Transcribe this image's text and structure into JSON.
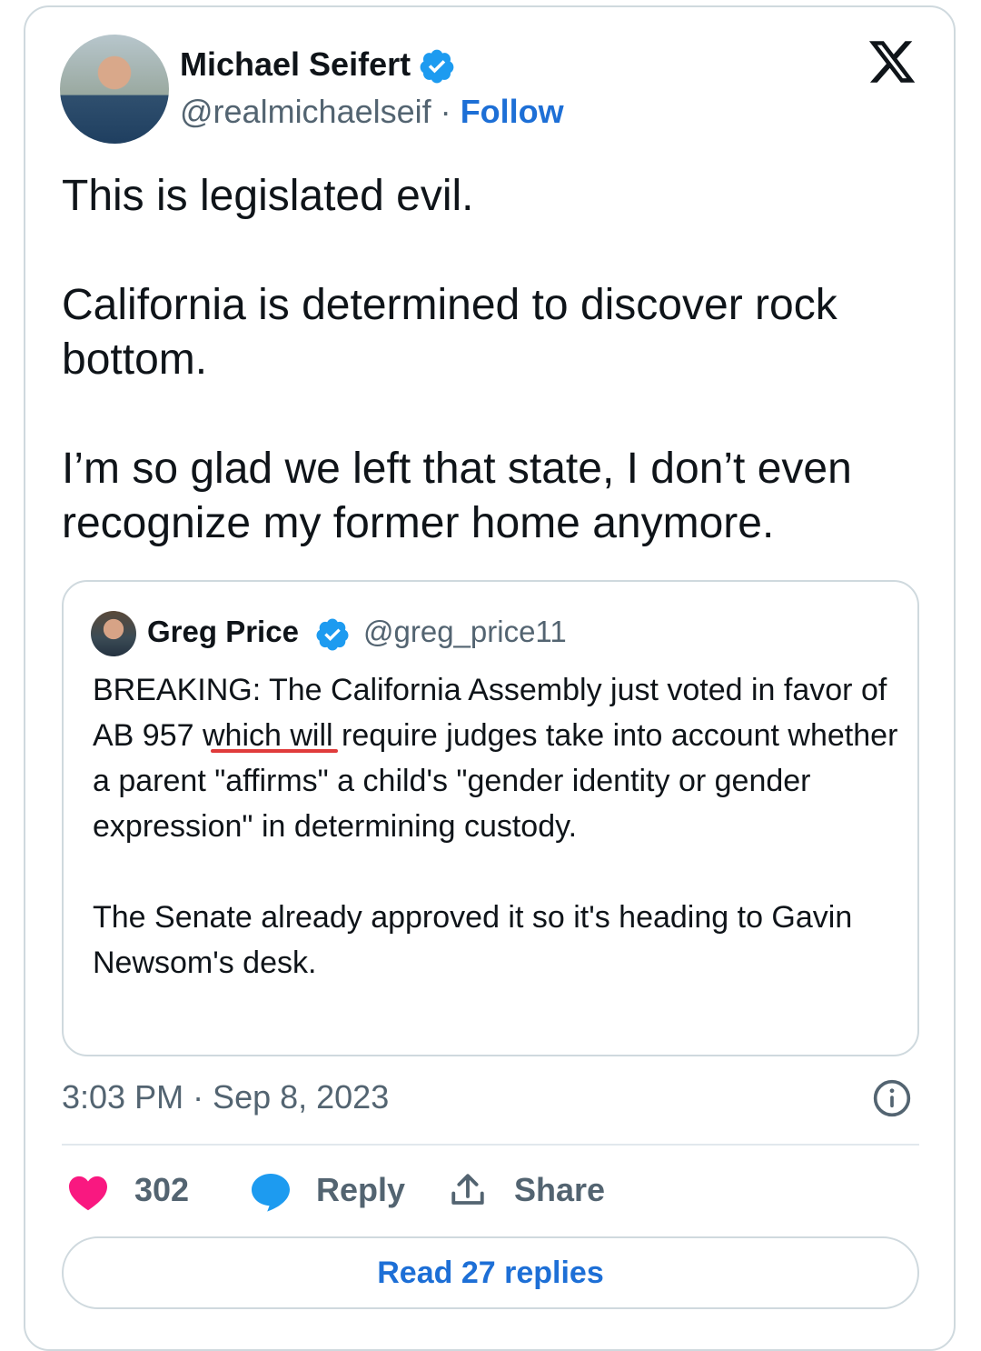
{
  "author": {
    "name": "Michael Seifert",
    "handle": "@realmichaelseif",
    "separator": "·",
    "follow_label": "Follow",
    "verified": true,
    "avatar_icon": "profile-photo"
  },
  "brand_icon": "x-logo-icon",
  "tweet": {
    "paragraphs": [
      "This is legislated evil.",
      "California is determined to discover rock bottom.",
      "I’m so glad we left that state, I don’t even recognize my former home anymore."
    ]
  },
  "quoted_tweet": {
    "name": "Greg Price",
    "handle": "@greg_price11",
    "verified": true,
    "paragraphs": [
      "BREAKING: The California Assembly just voted in favor of AB 957 which will require judges take into account whether a parent \"affirms\" a child's \"gender identity or gender expression\" in determining custody.",
      "The Senate already approved it so it's heading to Gavin Newsom's desk."
    ]
  },
  "timestamp": "3:03 PM · Sep 8, 2023",
  "actions": {
    "likes": "302",
    "reply_label": "Reply",
    "share_label": "Share"
  },
  "read_replies_label": "Read 27 replies",
  "colors": {
    "accent": "#1d6fd6",
    "like": "#f91880",
    "reply_icon": "#1d9bf0",
    "verified": "#1d9bf0",
    "annotation_underline": "#e03b3b"
  }
}
